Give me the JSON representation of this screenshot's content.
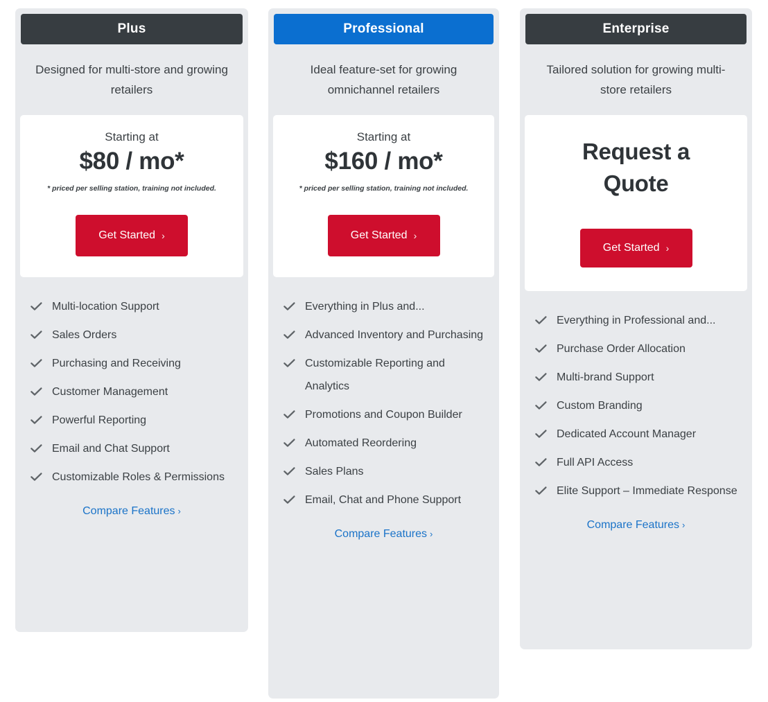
{
  "plans": [
    {
      "name": "Plus",
      "header_style": "dark",
      "tagline": "Designed for multi-store and growing retailers",
      "starting_at": "Starting at",
      "price": "$80 / mo*",
      "price_note": "* priced per selling station, training not included.",
      "cta_label": "Get Started",
      "cta_chevron": "›",
      "features": [
        "Multi-location Support",
        "Sales Orders",
        "Purchasing and Receiving",
        "Customer Management",
        "Powerful Reporting",
        "Email and Chat Support",
        "Customizable Roles & Permissions"
      ],
      "compare_label": "Compare Features",
      "compare_chevron": "›"
    },
    {
      "name": "Professional",
      "header_style": "blue",
      "tagline": "Ideal feature-set for growing omnichannel retailers",
      "starting_at": "Starting at",
      "price": "$160 / mo*",
      "price_note": "* priced per selling station, training not included.",
      "cta_label": "Get Started",
      "cta_chevron": "›",
      "features": [
        "Everything in Plus and...",
        "Advanced Inventory and Purchasing",
        "Customizable Reporting and Analytics",
        "Promotions and Coupon Builder",
        "Automated Reordering",
        "Sales Plans",
        "Email, Chat and Phone Support"
      ],
      "compare_label": "Compare Features",
      "compare_chevron": "›"
    },
    {
      "name": "Enterprise",
      "header_style": "dark",
      "tagline": "Tailored solution for growing multi-store retailers",
      "quote_title": "Request a Quote",
      "cta_label": "Get Started",
      "cta_chevron": "›",
      "features": [
        "Everything in Professional and...",
        "Purchase Order Allocation",
        "Multi-brand Support",
        "Custom Branding",
        "Dedicated Account Manager",
        "Full API Access",
        "Elite Support – Immediate Response"
      ],
      "compare_label": "Compare Features",
      "compare_chevron": "›"
    }
  ],
  "colors": {
    "header_dark": "#373d41",
    "header_blue": "#0b6fd0",
    "cta_red": "#ce0e2d",
    "link_blue": "#1a73c8",
    "card_bg": "#e8eaed",
    "text": "#3b4044",
    "check_gray": "#5f6468"
  },
  "icons": {
    "check": "check-icon",
    "chevron_right": "chevron-right-icon"
  }
}
